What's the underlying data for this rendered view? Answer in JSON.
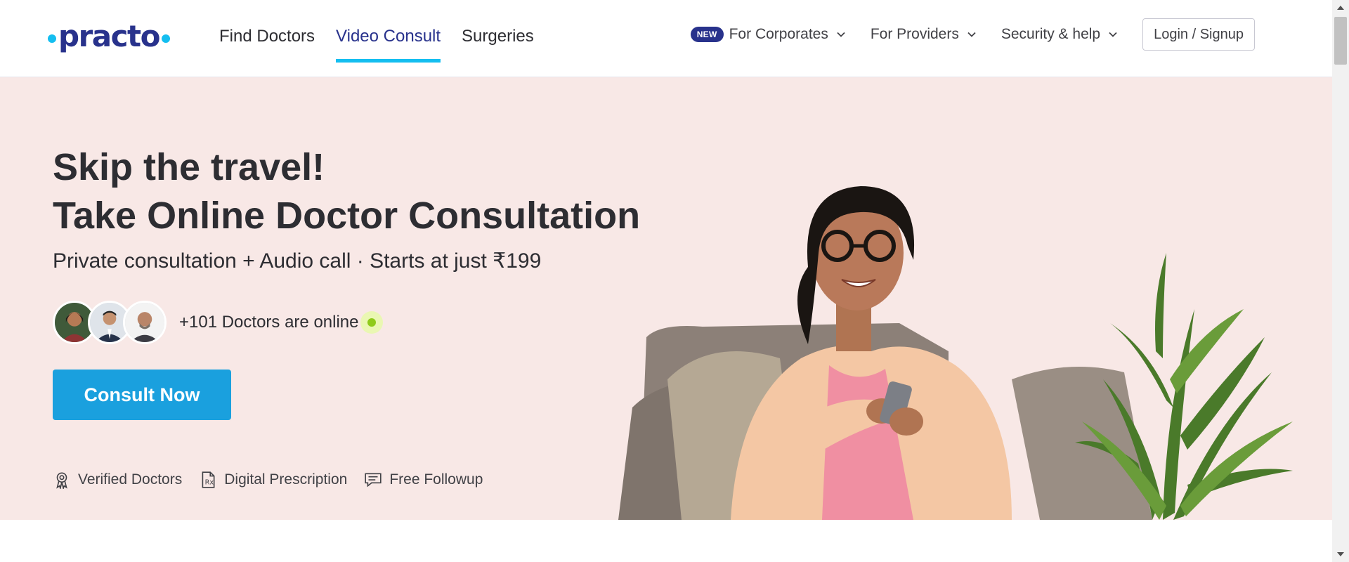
{
  "header": {
    "logo_text": "practo",
    "nav": [
      {
        "label": "Find Doctors",
        "active": false
      },
      {
        "label": "Video Consult",
        "active": true
      },
      {
        "label": "Surgeries",
        "active": false
      }
    ],
    "right_nav": {
      "new_badge": "NEW",
      "corporates_label": "For Corporates",
      "providers_label": "For Providers",
      "security_label": "Security & help",
      "login_label": "Login / Signup"
    }
  },
  "hero": {
    "title_line1": "Skip the travel!",
    "title_line2": "Take Online Doctor Consultation",
    "subtitle": "Private consultation + Audio call · Starts at just ₹199",
    "online_text": "+101 Doctors are online",
    "cta_label": "Consult Now",
    "features": [
      {
        "label": "Verified Doctors",
        "icon": "verified-badge-icon"
      },
      {
        "label": "Digital Prescription",
        "icon": "prescription-icon"
      },
      {
        "label": "Free Followup",
        "icon": "chat-icon"
      }
    ]
  },
  "colors": {
    "brand": "#28328c",
    "accent": "#14bef0",
    "cta": "#1aa0de",
    "hero_bg": "#f8e8e6",
    "online_dot": "#8fcb1a"
  }
}
